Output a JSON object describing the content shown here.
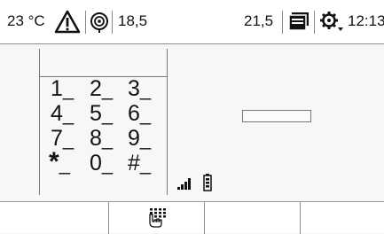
{
  "status_bar": {
    "temperature": "23 °C",
    "warning_icon": "warning-triangle-icon",
    "navigation_icon": "gps-target-icon",
    "left_value": "18,5",
    "right_value": "21,5",
    "message_icon": "message-list-icon",
    "settings_icon": "settings-gear-icon",
    "clock": "12:13"
  },
  "keypad": {
    "display_value": "",
    "rows": [
      [
        {
          "digit": "1",
          "mark": "_"
        },
        {
          "digit": "2",
          "mark": "_"
        },
        {
          "digit": "3",
          "mark": "_"
        }
      ],
      [
        {
          "digit": "4",
          "mark": "_"
        },
        {
          "digit": "5",
          "mark": "_"
        },
        {
          "digit": "6",
          "mark": "_"
        }
      ],
      [
        {
          "digit": "7",
          "mark": "_"
        },
        {
          "digit": "8",
          "mark": "_"
        },
        {
          "digit": "9",
          "mark": "_"
        }
      ],
      [
        {
          "digit": "*",
          "mark": "_"
        },
        {
          "digit": "0",
          "mark": "_"
        },
        {
          "digit": "#",
          "mark": "_"
        }
      ]
    ]
  },
  "indicators": {
    "signal_icon": "signal-strength-icon",
    "signal_bars": 4,
    "battery_icon": "battery-icon"
  },
  "input_field": {
    "value": ""
  },
  "bottom_bar": {
    "buttons": [
      {
        "icon": ""
      },
      {
        "icon": "keypad-hand-icon"
      },
      {
        "icon": ""
      },
      {
        "icon": ""
      }
    ]
  }
}
